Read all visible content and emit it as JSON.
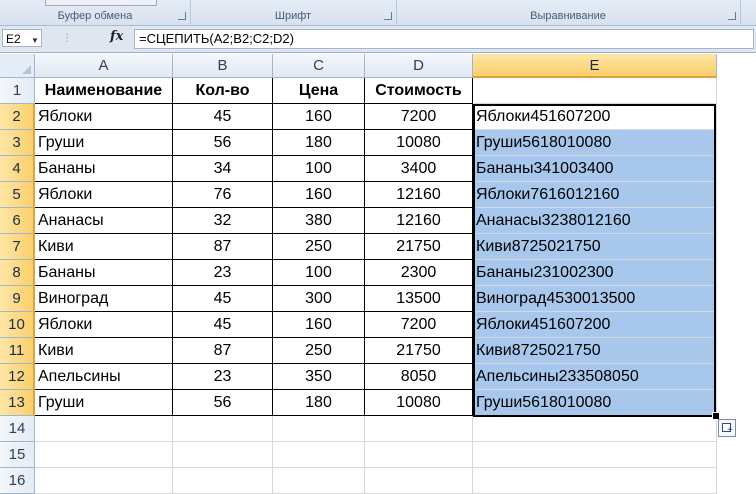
{
  "ribbon": {
    "groups": [
      {
        "label": "Буфер обмена"
      },
      {
        "label": "Шрифт"
      },
      {
        "label": "Выравнивание"
      }
    ]
  },
  "formula_bar": {
    "name_box": "E2",
    "fx_label": "fx",
    "formula": "=СЦЕПИТЬ(A2;B2;C2;D2)"
  },
  "columns": [
    "A",
    "B",
    "C",
    "D",
    "E"
  ],
  "rows": [
    "1",
    "2",
    "3",
    "4",
    "5",
    "6",
    "7",
    "8",
    "9",
    "10",
    "11",
    "12",
    "13",
    "14",
    "15",
    "16"
  ],
  "header_row": [
    "Наименование",
    "Кол-во",
    "Цена",
    "Стоимость",
    ""
  ],
  "data_rows": [
    [
      "Яблоки",
      "45",
      "160",
      "7200",
      "Яблоки451607200"
    ],
    [
      "Груши",
      "56",
      "180",
      "10080",
      "Груши5618010080"
    ],
    [
      "Бананы",
      "34",
      "100",
      "3400",
      "Бананы341003400"
    ],
    [
      "Яблоки",
      "76",
      "160",
      "12160",
      "Яблоки7616012160"
    ],
    [
      "Ананасы",
      "32",
      "380",
      "12160",
      "Ананасы3238012160"
    ],
    [
      "Киви",
      "87",
      "250",
      "21750",
      "Киви8725021750"
    ],
    [
      "Бананы",
      "23",
      "100",
      "2300",
      "Бананы231002300"
    ],
    [
      "Виноград",
      "45",
      "300",
      "13500",
      "Виноград4530013500"
    ],
    [
      "Яблоки",
      "45",
      "160",
      "7200",
      "Яблоки451607200"
    ],
    [
      "Киви",
      "87",
      "250",
      "21750",
      "Киви8725021750"
    ],
    [
      "Апельсины",
      "23",
      "350",
      "8050",
      "Апельсины233508050"
    ],
    [
      "Груши",
      "56",
      "180",
      "10080",
      "Груши5618010080"
    ]
  ],
  "selection": {
    "active_cell": "E2",
    "range": "E2:E13",
    "color": "#a7c8ec"
  }
}
